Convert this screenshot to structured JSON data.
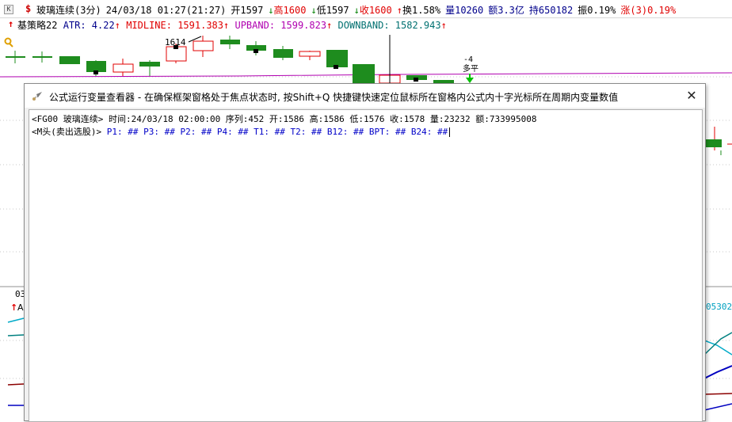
{
  "top_bar": {
    "k_box": "K",
    "dollar": "$",
    "symbol_name": "玻璃连续(3分)",
    "datetime": "24/03/18 01:27(21:27)",
    "open": "开1597",
    "high": "高1600",
    "low": "低1597",
    "close": "收1600",
    "turnover": "换1.58%",
    "volume": "量10260",
    "amount": "额3.3亿",
    "holding": "持650182",
    "amplitude": "振0.19%",
    "change": "涨(3)0.19%"
  },
  "indicator_bar": {
    "strategy": "基策略22",
    "atr": "ATR: 4.22",
    "midline": "MIDLINE: 1591.383",
    "upband": "UPBAND: 1599.823",
    "downband": "DOWNBAND: 1582.943"
  },
  "chart_labels": {
    "high_mark": "1614",
    "signal_num": "-4",
    "signal_text": "多平",
    "bottom_label": "03",
    "right_value": "05302"
  },
  "dialog": {
    "title": "公式运行变量查看器 - 在确保框架窗格处于焦点状态时, 按Shift+Q 快捷键快速定位鼠标所在窗格内公式内十字光标所在周期内变量数值",
    "close_symbol": "✕",
    "line1": "<FG00 玻璃连续> 时间:24/03/18 02:00:00 序列:452 开:1586 高:1586 低:1576 收:1578 量:23232 额:733995008",
    "line2_prefix": "<M头(卖出选股)> ",
    "line2_vars": "P1: ## P3: ## P2: ## P4: ## T1: ## T2: ## B12: ## BPT: ## B24: ##"
  },
  "colors": {
    "up_candle": "#e00000",
    "down_candle": "#1e8c1e",
    "midline": "#b000b0",
    "downband": "#007070"
  }
}
